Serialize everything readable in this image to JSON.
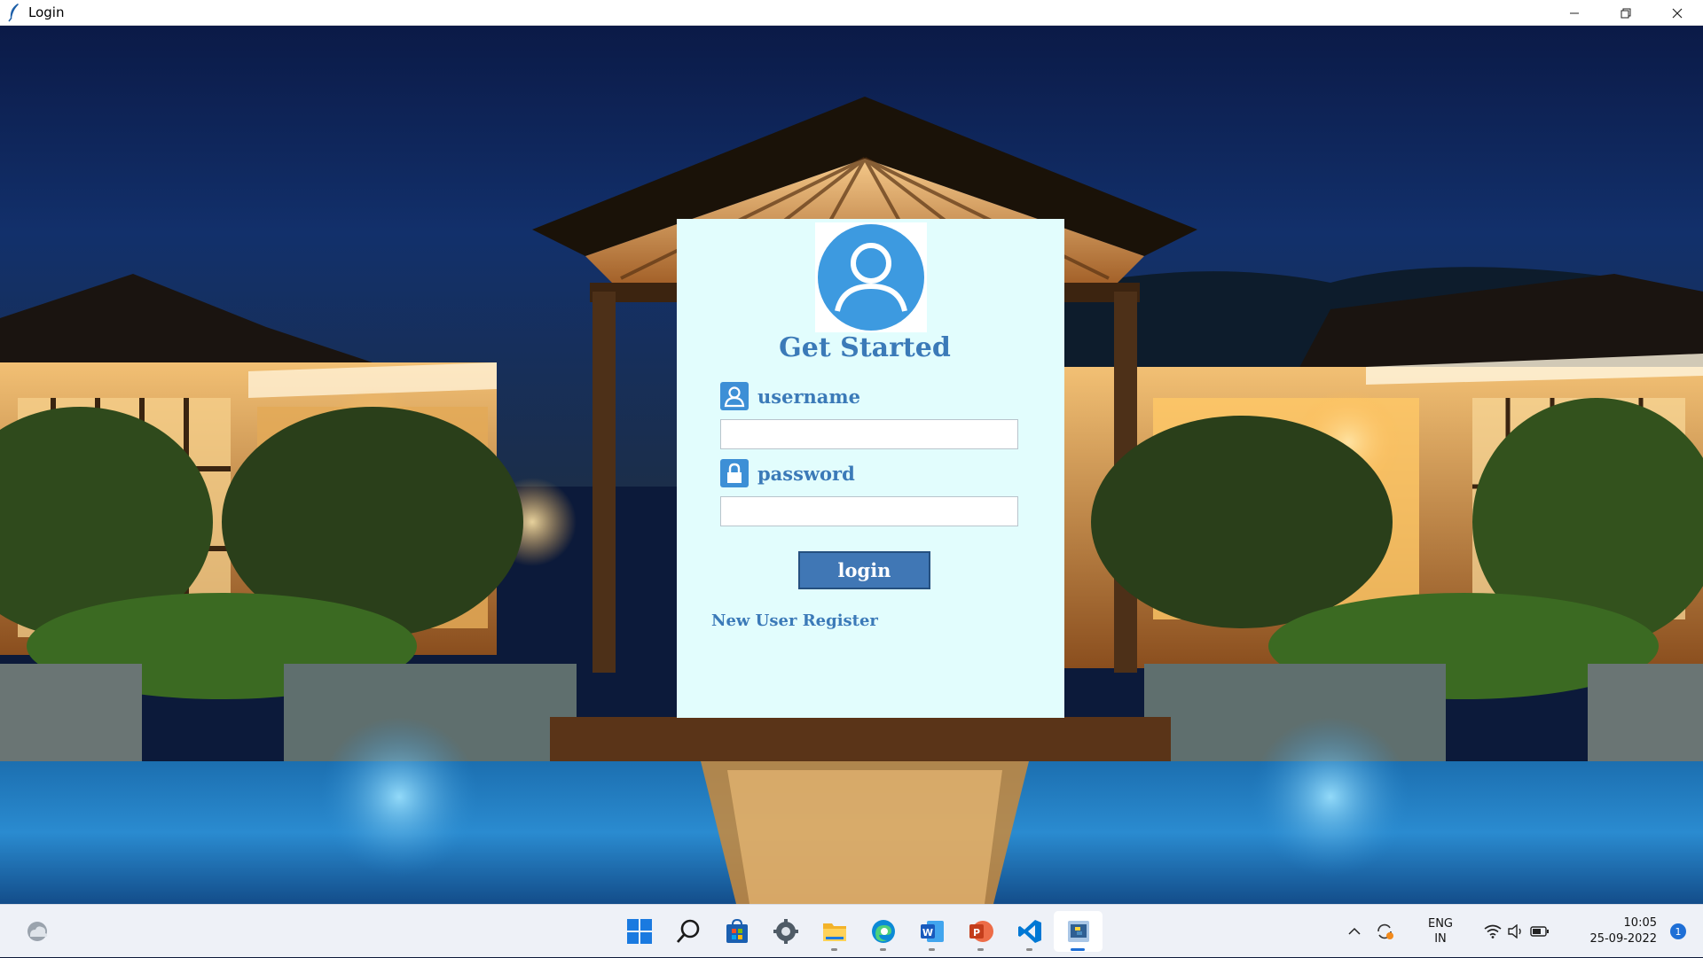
{
  "window": {
    "title": "Login",
    "controls": {
      "minimize_icon": "minimize-icon",
      "restore_icon": "restore-icon",
      "close_icon": "close-icon"
    }
  },
  "login": {
    "heading": "Get Started",
    "username_label": "username",
    "password_label": "password",
    "username_value": "",
    "password_value": "",
    "login_button": "login",
    "register_link": "New User Register"
  },
  "taskbar": {
    "apps": [
      "start-icon",
      "search-icon",
      "store-icon",
      "settings-icon",
      "file-explorer-icon",
      "edge-icon",
      "word-icon",
      "powerpoint-icon",
      "vscode-icon",
      "python-app-icon"
    ],
    "active_app": "python-app-icon",
    "language_line1": "ENG",
    "language_line2": "IN",
    "time": "10:05",
    "date": "25-09-2022",
    "notification_count": "1"
  },
  "colors": {
    "panel_bg": "#e2fdfd",
    "accent": "#3b7ab8",
    "button_bg": "#4077b5",
    "avatar": "#3d9ae0"
  }
}
